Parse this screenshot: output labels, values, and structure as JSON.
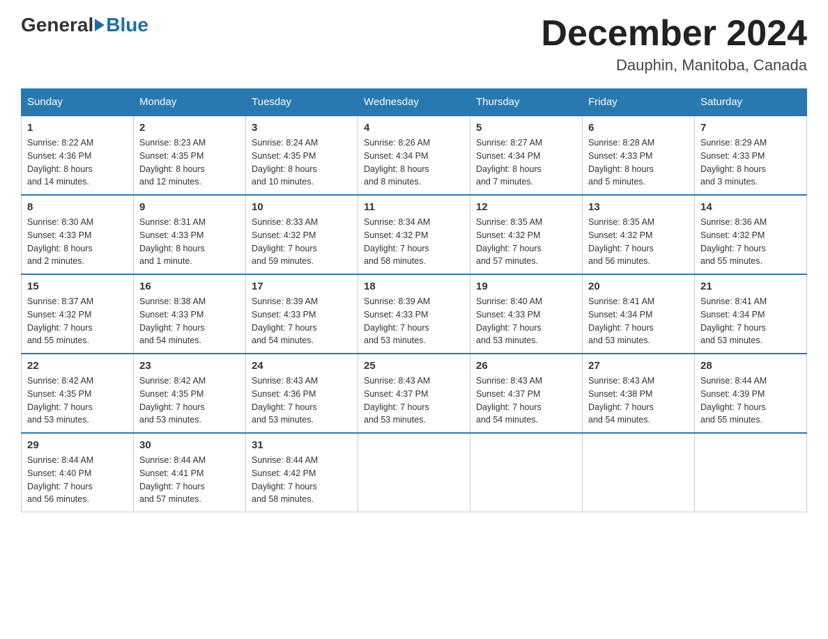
{
  "header": {
    "logo_general": "General",
    "logo_blue": "Blue",
    "title": "December 2024",
    "location": "Dauphin, Manitoba, Canada"
  },
  "weekdays": [
    "Sunday",
    "Monday",
    "Tuesday",
    "Wednesday",
    "Thursday",
    "Friday",
    "Saturday"
  ],
  "weeks": [
    [
      {
        "day": "1",
        "sunrise": "8:22 AM",
        "sunset": "4:36 PM",
        "daylight": "8 hours and 14 minutes."
      },
      {
        "day": "2",
        "sunrise": "8:23 AM",
        "sunset": "4:35 PM",
        "daylight": "8 hours and 12 minutes."
      },
      {
        "day": "3",
        "sunrise": "8:24 AM",
        "sunset": "4:35 PM",
        "daylight": "8 hours and 10 minutes."
      },
      {
        "day": "4",
        "sunrise": "8:26 AM",
        "sunset": "4:34 PM",
        "daylight": "8 hours and 8 minutes."
      },
      {
        "day": "5",
        "sunrise": "8:27 AM",
        "sunset": "4:34 PM",
        "daylight": "8 hours and 7 minutes."
      },
      {
        "day": "6",
        "sunrise": "8:28 AM",
        "sunset": "4:33 PM",
        "daylight": "8 hours and 5 minutes."
      },
      {
        "day": "7",
        "sunrise": "8:29 AM",
        "sunset": "4:33 PM",
        "daylight": "8 hours and 3 minutes."
      }
    ],
    [
      {
        "day": "8",
        "sunrise": "8:30 AM",
        "sunset": "4:33 PM",
        "daylight": "8 hours and 2 minutes."
      },
      {
        "day": "9",
        "sunrise": "8:31 AM",
        "sunset": "4:33 PM",
        "daylight": "8 hours and 1 minute."
      },
      {
        "day": "10",
        "sunrise": "8:33 AM",
        "sunset": "4:32 PM",
        "daylight": "7 hours and 59 minutes."
      },
      {
        "day": "11",
        "sunrise": "8:34 AM",
        "sunset": "4:32 PM",
        "daylight": "7 hours and 58 minutes."
      },
      {
        "day": "12",
        "sunrise": "8:35 AM",
        "sunset": "4:32 PM",
        "daylight": "7 hours and 57 minutes."
      },
      {
        "day": "13",
        "sunrise": "8:35 AM",
        "sunset": "4:32 PM",
        "daylight": "7 hours and 56 minutes."
      },
      {
        "day": "14",
        "sunrise": "8:36 AM",
        "sunset": "4:32 PM",
        "daylight": "7 hours and 55 minutes."
      }
    ],
    [
      {
        "day": "15",
        "sunrise": "8:37 AM",
        "sunset": "4:32 PM",
        "daylight": "7 hours and 55 minutes."
      },
      {
        "day": "16",
        "sunrise": "8:38 AM",
        "sunset": "4:33 PM",
        "daylight": "7 hours and 54 minutes."
      },
      {
        "day": "17",
        "sunrise": "8:39 AM",
        "sunset": "4:33 PM",
        "daylight": "7 hours and 54 minutes."
      },
      {
        "day": "18",
        "sunrise": "8:39 AM",
        "sunset": "4:33 PM",
        "daylight": "7 hours and 53 minutes."
      },
      {
        "day": "19",
        "sunrise": "8:40 AM",
        "sunset": "4:33 PM",
        "daylight": "7 hours and 53 minutes."
      },
      {
        "day": "20",
        "sunrise": "8:41 AM",
        "sunset": "4:34 PM",
        "daylight": "7 hours and 53 minutes."
      },
      {
        "day": "21",
        "sunrise": "8:41 AM",
        "sunset": "4:34 PM",
        "daylight": "7 hours and 53 minutes."
      }
    ],
    [
      {
        "day": "22",
        "sunrise": "8:42 AM",
        "sunset": "4:35 PM",
        "daylight": "7 hours and 53 minutes."
      },
      {
        "day": "23",
        "sunrise": "8:42 AM",
        "sunset": "4:35 PM",
        "daylight": "7 hours and 53 minutes."
      },
      {
        "day": "24",
        "sunrise": "8:43 AM",
        "sunset": "4:36 PM",
        "daylight": "7 hours and 53 minutes."
      },
      {
        "day": "25",
        "sunrise": "8:43 AM",
        "sunset": "4:37 PM",
        "daylight": "7 hours and 53 minutes."
      },
      {
        "day": "26",
        "sunrise": "8:43 AM",
        "sunset": "4:37 PM",
        "daylight": "7 hours and 54 minutes."
      },
      {
        "day": "27",
        "sunrise": "8:43 AM",
        "sunset": "4:38 PM",
        "daylight": "7 hours and 54 minutes."
      },
      {
        "day": "28",
        "sunrise": "8:44 AM",
        "sunset": "4:39 PM",
        "daylight": "7 hours and 55 minutes."
      }
    ],
    [
      {
        "day": "29",
        "sunrise": "8:44 AM",
        "sunset": "4:40 PM",
        "daylight": "7 hours and 56 minutes."
      },
      {
        "day": "30",
        "sunrise": "8:44 AM",
        "sunset": "4:41 PM",
        "daylight": "7 hours and 57 minutes."
      },
      {
        "day": "31",
        "sunrise": "8:44 AM",
        "sunset": "4:42 PM",
        "daylight": "7 hours and 58 minutes."
      },
      null,
      null,
      null,
      null
    ]
  ],
  "labels": {
    "sunrise": "Sunrise:",
    "sunset": "Sunset:",
    "daylight": "Daylight:"
  }
}
